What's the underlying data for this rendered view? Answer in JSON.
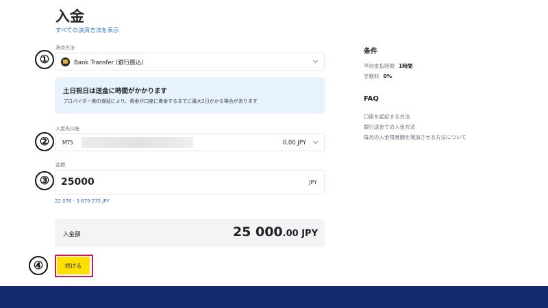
{
  "page": {
    "title": "入金",
    "all_methods_link": "すべての決済方法を表示"
  },
  "payment_method": {
    "label": "決済方法",
    "value": "Bank Transfer (銀行振込)"
  },
  "notice": {
    "title": "土日祝日は送金に時間がかかります",
    "body": "プロバイダー側の遅延により、資金が口座に着金するまでに最大2日かかる場合があります"
  },
  "account": {
    "label": "入金先口座",
    "type": "MT5",
    "balance": "0.00 JPY"
  },
  "amount": {
    "label": "金額",
    "value": "25000",
    "currency": "JPY",
    "range": "22 076 - 3 679 275 JPY"
  },
  "summary": {
    "label": "入金額",
    "amount_int": "25 000",
    "amount_dec": ".00",
    "currency": " JPY"
  },
  "continue_button": "続ける",
  "step_markers": [
    "①",
    "②",
    "③",
    "④"
  ],
  "conditions": {
    "heading": "条件",
    "processing_time_label": "平均支払時間",
    "processing_time_value": "1時間",
    "fee_label": "手数料",
    "fee_value": "0%"
  },
  "faq": {
    "heading": "FAQ",
    "links": [
      "口座を認証する方法",
      "銀行送金での入金方法",
      "毎月の入金限度額を増加させる方法について"
    ]
  },
  "colors": {
    "accent_yellow": "#ffde02",
    "highlight_outline": "#c2185b",
    "link_blue": "#2f6fd0",
    "footer_navy": "#14286e",
    "notice_bg": "#e8f2fc"
  }
}
